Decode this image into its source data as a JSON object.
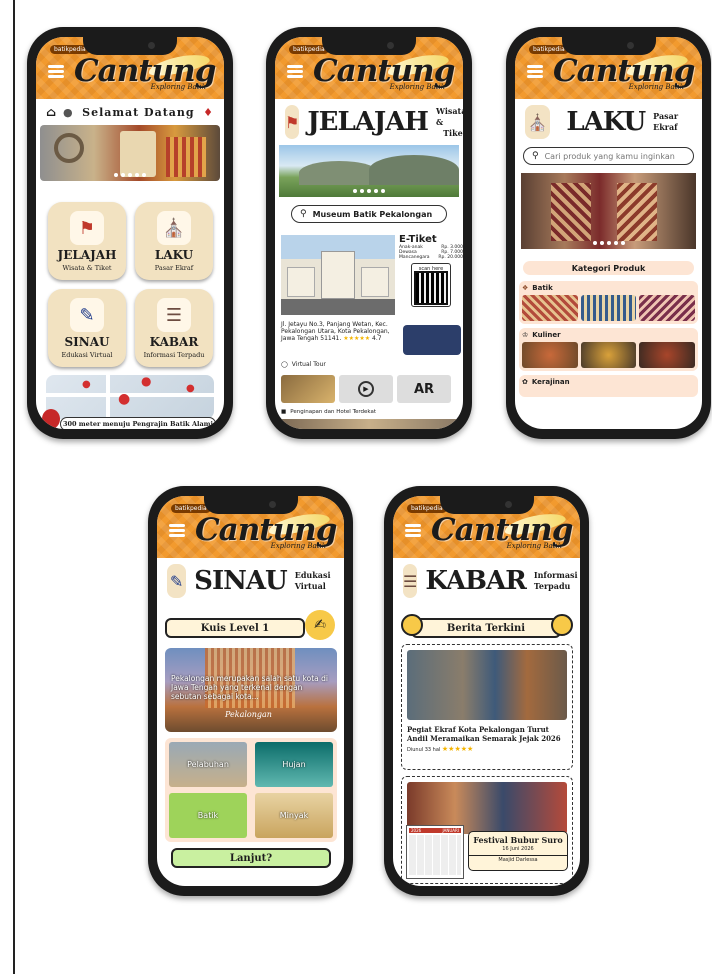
{
  "brand": {
    "name": "Cantung",
    "tagline": "Exploring Batik",
    "badge": "batikpedia"
  },
  "phone1": {
    "welcome": "Selamat Datang",
    "tiles": [
      {
        "title": "JELAJAH",
        "sub": "Wisata & Tiket"
      },
      {
        "title": "LAKU",
        "sub": "Pasar Ekraf"
      },
      {
        "title": "SINAU",
        "sub": "Edukasi Virtual"
      },
      {
        "title": "KABAR",
        "sub": "Informasi Terpadu"
      }
    ],
    "map_note": "300 meter menuju Pengrajin Batik Alami"
  },
  "phone2": {
    "title": "JELAJAH",
    "sub1": "Wisata &",
    "sub2": "Tiket",
    "search": "Museum Batik Pekalongan",
    "eticket": "E-Tiket",
    "prices": [
      {
        "label": "Anak-anak",
        "price": "Rp. 3.000"
      },
      {
        "label": "Dewasa",
        "price": "Rp. 7.000"
      },
      {
        "label": "Mancanegara",
        "price": "Rp. 20.000"
      }
    ],
    "scan": "scan here",
    "address": "Jl. Jetayu No.3, Panjang Wetan, Kec. Pekalongan Utara, Kota Pekalongan, Jawa Tengah 51141.",
    "stars": "★★★★★",
    "rating": "4.7",
    "virtual_tour": "Virtual Tour",
    "ar": "AR",
    "lodging": "Penginapan dan Hotel Terdekat"
  },
  "phone3": {
    "title": "LAKU",
    "sub": "Pasar Ekraf",
    "search": "Cari produk yang kamu inginkan",
    "kategori": "Kategori Produk",
    "cats": [
      "Batik",
      "Kuliner",
      "Kerajinan"
    ]
  },
  "phone4": {
    "title": "SINAU",
    "sub": "Edukasi Virtual",
    "quiz": "Kuis Level 1",
    "banner_text": "Pekalongan merupakan salah satu kota di Jawa Tengah yang terkenal dengan sebutan sebagai kota...",
    "banner_sign": "Pekalongan",
    "options": [
      "Pelabuhan",
      "Hujan",
      "Batik",
      "Minyak"
    ],
    "next": "Lanjut?"
  },
  "phone5": {
    "title": "KABAR",
    "sub1": "Informasi",
    "sub2": "Terpadu",
    "section": "Berita Terkini",
    "news1": "Pegiat Ekraf Kota Pekalongan Turut Andil Meramaikan Semarak Jejak 2026",
    "news1_time": "Diunul 33 hal",
    "news1_stars": "★★★★★",
    "event": "Festival Bubur Suro",
    "event_date": "16 Juni 2026",
    "event_place": "Masjid Darlessa",
    "cal_month": "2026",
    "cal_label": "JANUARI"
  },
  "colors": {
    "orange": "#f29a2e",
    "tan": "#f2e2c1",
    "peach": "#fde5d4",
    "yellow": "#f7c948",
    "green": "#c9f0a0"
  }
}
